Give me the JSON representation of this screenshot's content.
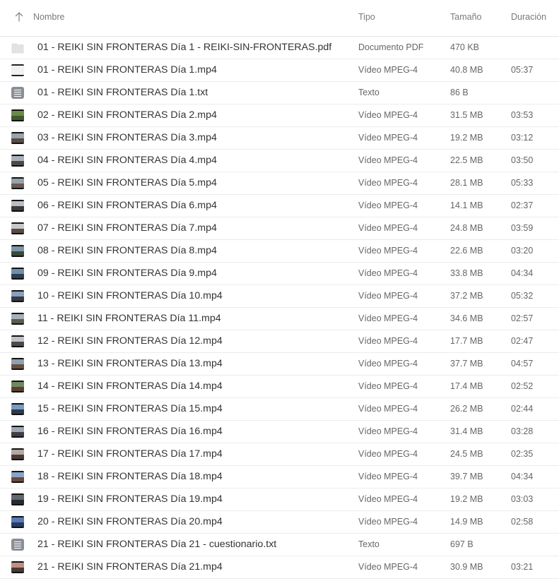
{
  "header": {
    "name": "Nombre",
    "type": "Tipo",
    "size": "Tamaño",
    "duration": "Duración"
  },
  "rows": [
    {
      "name": "01 - REIKI SIN FRONTERAS Día 1 - REIKI-SIN-FRONTERAS.pdf",
      "type": "Documento PDF",
      "size": "470 KB",
      "duration": "",
      "icon": "pdf-icon"
    },
    {
      "name": "01 - REIKI SIN FRONTERAS Día 1.mp4",
      "type": "Vídeo MPEG-4",
      "size": "40.8 MB",
      "duration": "05:37",
      "icon": "video-thumbnail"
    },
    {
      "name": "01 - REIKI SIN FRONTERAS Día 1.txt",
      "type": "Texto",
      "size": "86 B",
      "duration": "",
      "icon": "text-file-icon"
    },
    {
      "name": "02 - REIKI SIN FRONTERAS Día 2.mp4",
      "type": "Vídeo MPEG-4",
      "size": "31.5 MB",
      "duration": "03:53",
      "icon": "video-thumbnail"
    },
    {
      "name": "03 - REIKI SIN FRONTERAS Día 3.mp4",
      "type": "Vídeo MPEG-4",
      "size": "19.2 MB",
      "duration": "03:12",
      "icon": "video-thumbnail"
    },
    {
      "name": "04 - REIKI SIN FRONTERAS Día 4.mp4",
      "type": "Vídeo MPEG-4",
      "size": "22.5 MB",
      "duration": "03:50",
      "icon": "video-thumbnail"
    },
    {
      "name": "05 - REIKI SIN FRONTERAS Día 5.mp4",
      "type": "Vídeo MPEG-4",
      "size": "28.1 MB",
      "duration": "05:33",
      "icon": "video-thumbnail"
    },
    {
      "name": "06 - REIKI SIN FRONTERAS Día 6.mp4",
      "type": "Vídeo MPEG-4",
      "size": "14.1 MB",
      "duration": "02:37",
      "icon": "video-thumbnail"
    },
    {
      "name": "07 - REIKI SIN FRONTERAS Día 7.mp4",
      "type": "Vídeo MPEG-4",
      "size": "24.8 MB",
      "duration": "03:59",
      "icon": "video-thumbnail"
    },
    {
      "name": "08 - REIKI SIN FRONTERAS Día 8.mp4",
      "type": "Vídeo MPEG-4",
      "size": "22.6 MB",
      "duration": "03:20",
      "icon": "video-thumbnail"
    },
    {
      "name": "09 - REIKI SIN FRONTERAS Día 9.mp4",
      "type": "Vídeo MPEG-4",
      "size": "33.8 MB",
      "duration": "04:34",
      "icon": "video-thumbnail"
    },
    {
      "name": "10 - REIKI SIN FRONTERAS Día 10.mp4",
      "type": "Vídeo MPEG-4",
      "size": "37.2 MB",
      "duration": "05:32",
      "icon": "video-thumbnail"
    },
    {
      "name": "11 - REIKI SIN FRONTERAS Día 11.mp4",
      "type": "Vídeo MPEG-4",
      "size": "34.6 MB",
      "duration": "02:57",
      "icon": "video-thumbnail"
    },
    {
      "name": "12 - REIKI SIN FRONTERAS Día 12.mp4",
      "type": "Vídeo MPEG-4",
      "size": "17.7 MB",
      "duration": "02:47",
      "icon": "video-thumbnail"
    },
    {
      "name": "13 - REIKI SIN FRONTERAS Día 13.mp4",
      "type": "Vídeo MPEG-4",
      "size": "37.7 MB",
      "duration": "04:57",
      "icon": "video-thumbnail"
    },
    {
      "name": "14 - REIKI SIN FRONTERAS Día 14.mp4",
      "type": "Vídeo MPEG-4",
      "size": "17.4 MB",
      "duration": "02:52",
      "icon": "video-thumbnail"
    },
    {
      "name": "15 - REIKI SIN FRONTERAS Día 15.mp4",
      "type": "Vídeo MPEG-4",
      "size": "26.2 MB",
      "duration": "02:44",
      "icon": "video-thumbnail"
    },
    {
      "name": "16 - REIKI SIN FRONTERAS Día 16.mp4",
      "type": "Vídeo MPEG-4",
      "size": "31.4 MB",
      "duration": "03:28",
      "icon": "video-thumbnail"
    },
    {
      "name": "17 - REIKI SIN FRONTERAS Día 17.mp4",
      "type": "Vídeo MPEG-4",
      "size": "24.5 MB",
      "duration": "02:35",
      "icon": "video-thumbnail"
    },
    {
      "name": "18 - REIKI SIN FRONTERAS Día 18.mp4",
      "type": "Vídeo MPEG-4",
      "size": "39.7 MB",
      "duration": "04:34",
      "icon": "video-thumbnail"
    },
    {
      "name": "19 - REIKI SIN FRONTERAS Día 19.mp4",
      "type": "Vídeo MPEG-4",
      "size": "19.2 MB",
      "duration": "03:03",
      "icon": "video-thumbnail"
    },
    {
      "name": "20 - REIKI SIN FRONTERAS Día 20.mp4",
      "type": "Vídeo MPEG-4",
      "size": "14.9 MB",
      "duration": "02:58",
      "icon": "video-thumbnail"
    },
    {
      "name": "21 - REIKI SIN FRONTERAS Día 21 - cuestionario.txt",
      "type": "Texto",
      "size": "697 B",
      "duration": "",
      "icon": "text-file-icon"
    },
    {
      "name": "21 - REIKI SIN FRONTERAS Día 21.mp4",
      "type": "Vídeo MPEG-4",
      "size": "30.9 MB",
      "duration": "03:21",
      "icon": "video-thumbnail"
    }
  ],
  "thumb_colors": [
    null,
    [
      "#f2f2f2",
      "#f2f2f2"
    ],
    null,
    [
      "#6b8a4a",
      "#3f5a2a"
    ],
    [
      "#9aa4b0",
      "#5a4a44"
    ],
    [
      "#a9b2bc",
      "#4a4a4a"
    ],
    [
      "#9aa0a8",
      "#6a5a52"
    ],
    [
      "#b8bec6",
      "#3e3a38"
    ],
    [
      "#c8c8c8",
      "#5a4a46"
    ],
    [
      "#7c96a8",
      "#3a4a3a"
    ],
    [
      "#6f8fb0",
      "#2e3e4e"
    ],
    [
      "#8aa0c0",
      "#3a3a44"
    ],
    [
      "#a8b0b8",
      "#5a5a50"
    ],
    [
      "#c0c4c8",
      "#4a4a4a"
    ],
    [
      "#8fa0b0",
      "#6a5040"
    ],
    [
      "#708a60",
      "#5a4030"
    ],
    [
      "#7a9ac0",
      "#2e3a4a"
    ],
    [
      "#a0a8b4",
      "#3e3e46"
    ],
    [
      "#b4a8a0",
      "#4a3a3a"
    ],
    [
      "#8aa4c8",
      "#6a4a40"
    ],
    [
      "#606870",
      "#2a2a2e"
    ],
    [
      "#5a7ab8",
      "#2a3a66"
    ],
    null,
    [
      "#c09080",
      "#4a3a36"
    ]
  ]
}
